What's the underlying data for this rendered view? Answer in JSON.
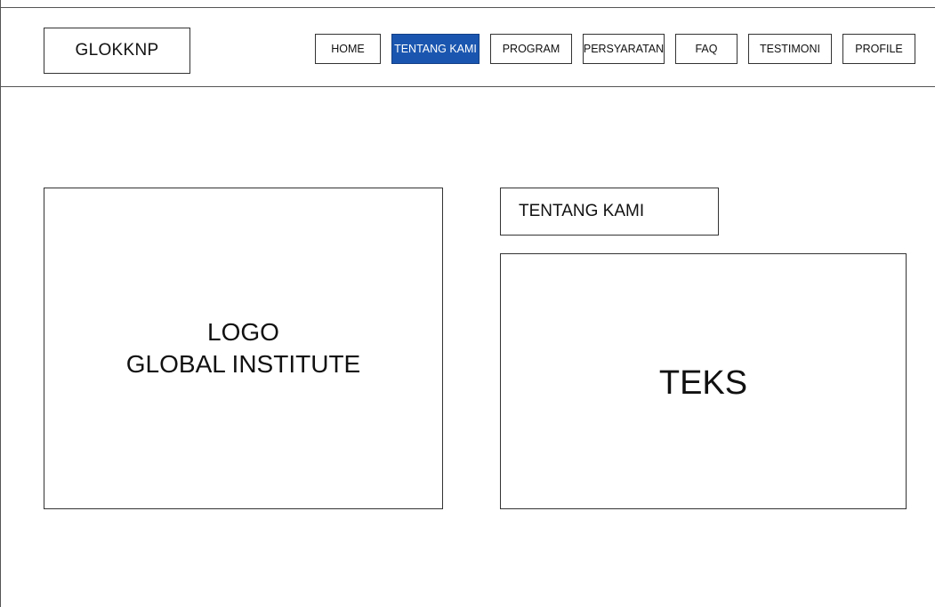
{
  "header": {
    "brand": "GLOKKNP",
    "nav": [
      {
        "label": "HOME",
        "active": false
      },
      {
        "label": "TENTANG KAMI",
        "active": true
      },
      {
        "label": "PROGRAM",
        "active": false
      },
      {
        "label": "PERSYARATAN",
        "active": false
      },
      {
        "label": "FAQ",
        "active": false
      },
      {
        "label": "TESTIMONI",
        "active": false
      },
      {
        "label": "PROFILE",
        "active": false
      }
    ]
  },
  "main": {
    "logo_line1": "LOGO",
    "logo_line2": "GLOBAL INSTITUTE",
    "section_title": "TENTANG KAMI",
    "body_text": "TEKS"
  },
  "colors": {
    "active_nav_bg": "#1a56b0",
    "border": "#333333"
  }
}
